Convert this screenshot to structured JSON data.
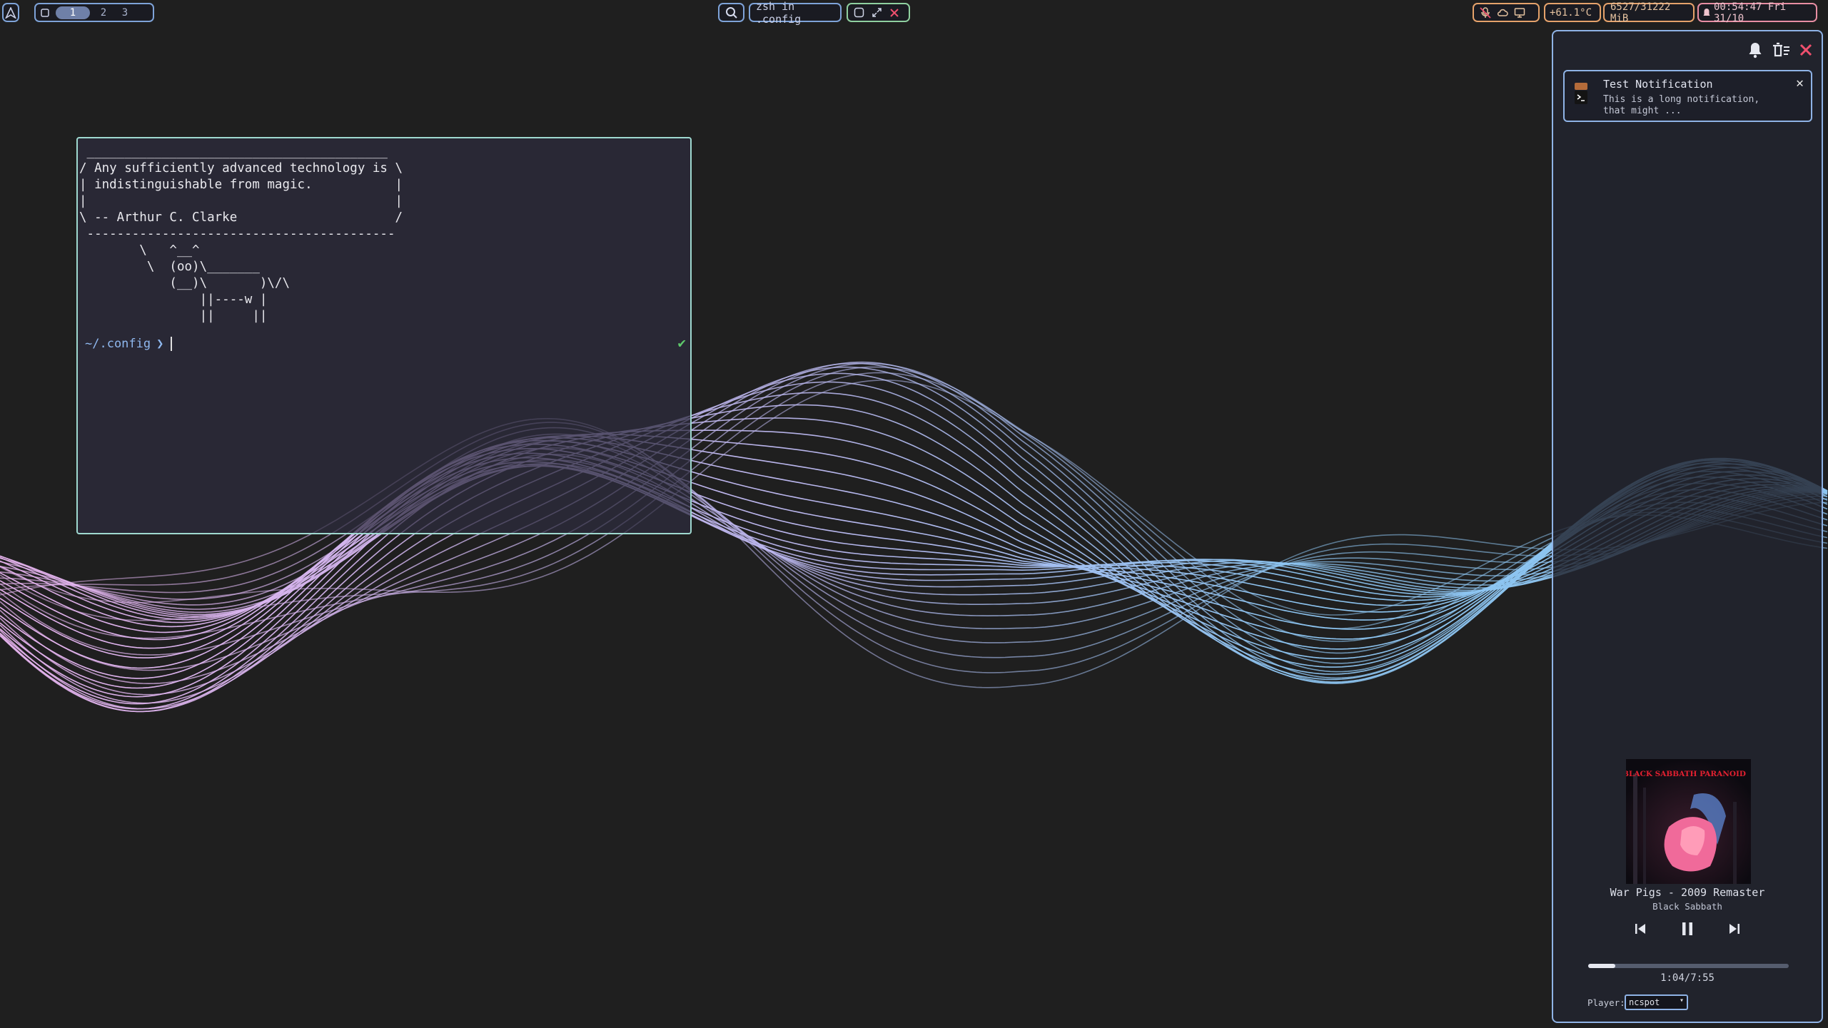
{
  "topbar": {
    "workspaces": [
      "1",
      "2",
      "3"
    ],
    "active_workspace": "1",
    "window_title": "zsh in .config",
    "temperature": "+61.1°C",
    "memory": "6527/31222 MiB",
    "clock": "00:54:47 Fri 31/10"
  },
  "terminal": {
    "fortune_art": " ________________________________________\n/ Any sufficiently advanced technology is \\\n| indistinguishable from magic.           |\n|                                         |\n\\ -- Arthur C. Clarke                     /\n -----------------------------------------\n        \\   ^__^\n         \\  (oo)\\_______\n            (__)\\       )\\/\\\n                ||----w |\n                ||     ||",
    "prompt_dir": "~/.config",
    "prompt_arrow": "❯"
  },
  "notifications": {
    "items": [
      {
        "title": "Test Notification",
        "body": "This is a long notification, that might ..."
      }
    ]
  },
  "media": {
    "album_art_text": "BLACK SABBATH PARANOID",
    "title": "War Pigs - 2009 Remaster",
    "artist": "Black Sabbath",
    "position": "1:04",
    "duration": "7:55",
    "time_display": "1:04/7:55",
    "progress_fraction": 0.135,
    "player_label": "Player:",
    "player_selected": "ncspot"
  },
  "icons": {
    "launcher": "arch-icon",
    "search": "search-icon",
    "bell": "bell-icon",
    "clear_all": "clear-all-icon",
    "close": "close-icon",
    "prev": "previous-track-icon",
    "pause": "pause-icon",
    "next": "next-track-icon"
  },
  "colors": {
    "background": "#1f1f1f",
    "accent_blue": "#7ea3d8",
    "accent_orange": "#e5a26b",
    "accent_pink": "#e88ea3",
    "close_red": "#f0506e",
    "wave_start": "#e2b0ec",
    "wave_end": "#8ec6f3"
  }
}
